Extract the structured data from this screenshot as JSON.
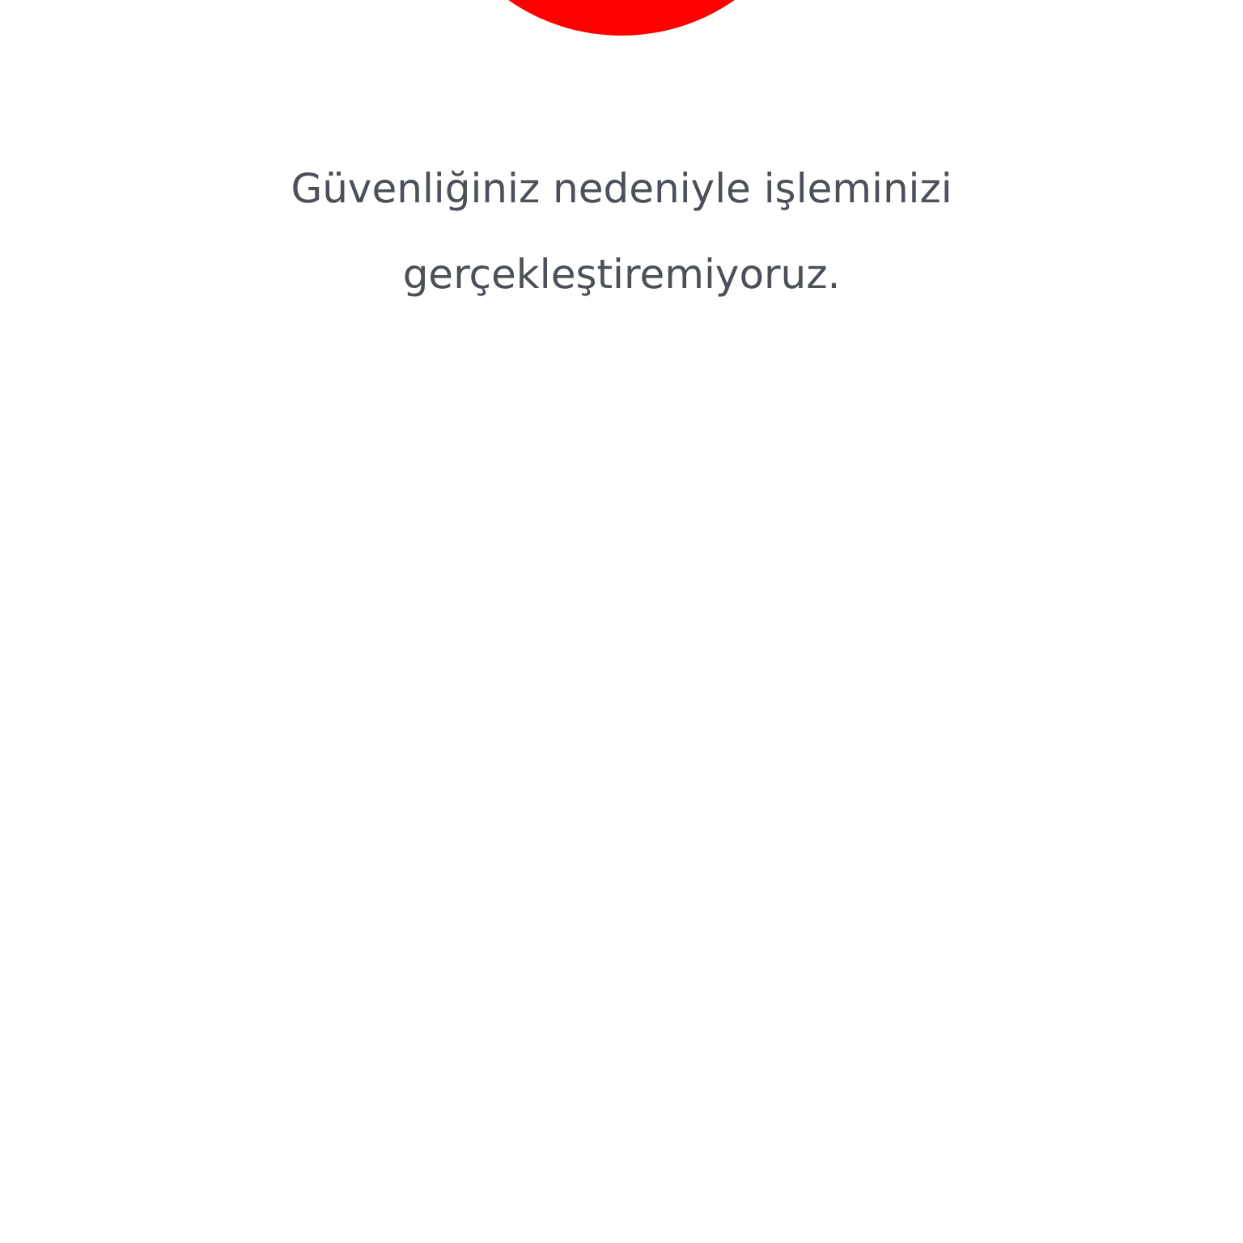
{
  "message": "Güvenliğiniz nedeniyle işleminizi gerçekleştiremiyoruz."
}
